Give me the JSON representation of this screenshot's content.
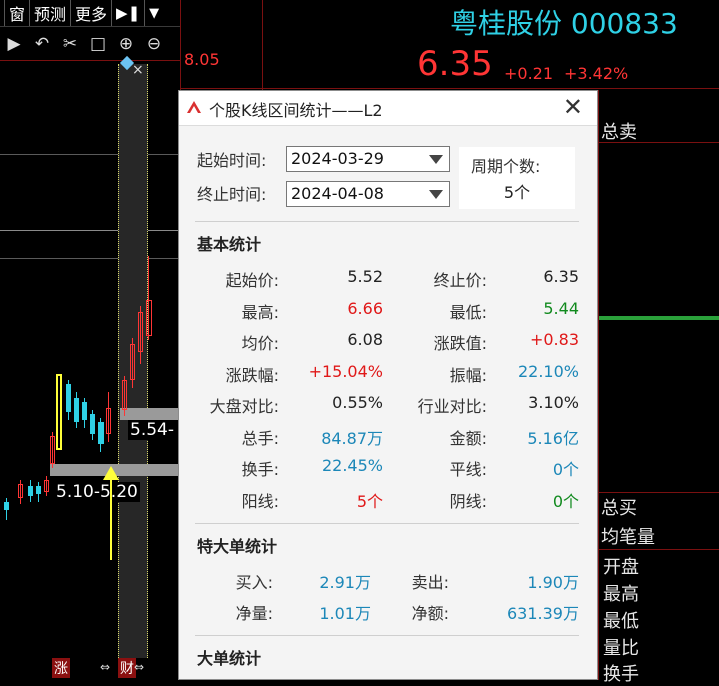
{
  "toolbar": {
    "menu": [
      "窗",
      "预测",
      "更多"
    ],
    "price_scale_value": "8.05"
  },
  "quote": {
    "title": "粤桂股份 000833",
    "price": "6.35",
    "change": "+0.21",
    "change_pct": "+3.42%"
  },
  "side_panel": {
    "labels_top": [
      "总卖"
    ],
    "labels_bottom": [
      "总买",
      "均笔量",
      "开盘",
      "最高",
      "最低",
      "量比",
      "换手"
    ]
  },
  "chart": {
    "range_labels": [
      "5.10-5.20",
      "5.54-"
    ],
    "bottom_marks": [
      "涨",
      "财"
    ]
  },
  "dialog": {
    "title": "个股K线区间统计——L2",
    "start_label": "起始时间:",
    "start_value": "2024-03-29",
    "end_label": "终止时间:",
    "end_value": "2024-04-08",
    "period_label": "周期个数:",
    "period_value": "5个",
    "section_basic": "基本统计",
    "basic": [
      {
        "k1": "起始价:",
        "v1": "5.52",
        "c1": "dark",
        "k2": "终止价:",
        "v2": "6.35",
        "c2": "dark"
      },
      {
        "k1": "最高:",
        "v1": "6.66",
        "c1": "red",
        "k2": "最低:",
        "v2": "5.44",
        "c2": "green"
      },
      {
        "k1": "均价:",
        "v1": "6.08",
        "c1": "dark",
        "k2": "涨跌值:",
        "v2": "+0.83",
        "c2": "red"
      },
      {
        "k1": "涨跌幅:",
        "v1": "+15.04%",
        "c1": "red",
        "k2": "振幅:",
        "v2": "22.10%",
        "c2": "blue"
      },
      {
        "k1": "大盘对比:",
        "v1": "0.55%",
        "c1": "dark",
        "k2": "行业对比:",
        "v2": "3.10%",
        "c2": "dark"
      },
      {
        "k1": "总手:",
        "v1": "84.87万",
        "c1": "blue",
        "k2": "金额:",
        "v2": "5.16亿",
        "c2": "blue"
      },
      {
        "k1": "换手:",
        "v1": "22.45%",
        "c1": "blue",
        "k2": "平线:",
        "v2": "0个",
        "c2": "blue"
      },
      {
        "k1": "阳线:",
        "v1": "5个",
        "c1": "red",
        "k2": "阴线:",
        "v2": "0个",
        "c2": "green"
      }
    ],
    "section_super": "特大单统计",
    "super": [
      {
        "k1": "买入:",
        "v1": "2.91万",
        "k2": "卖出:",
        "v2": "1.90万"
      },
      {
        "k1": "净量:",
        "v1": "1.01万",
        "k2": "净额:",
        "v2": "631.39万"
      }
    ],
    "section_large": "大单统计"
  },
  "colors": {
    "up": "#ff3535",
    "down": "#2fd1e6",
    "accent": "#2fd1e6",
    "dialog_bg": "#f4f4f4"
  }
}
